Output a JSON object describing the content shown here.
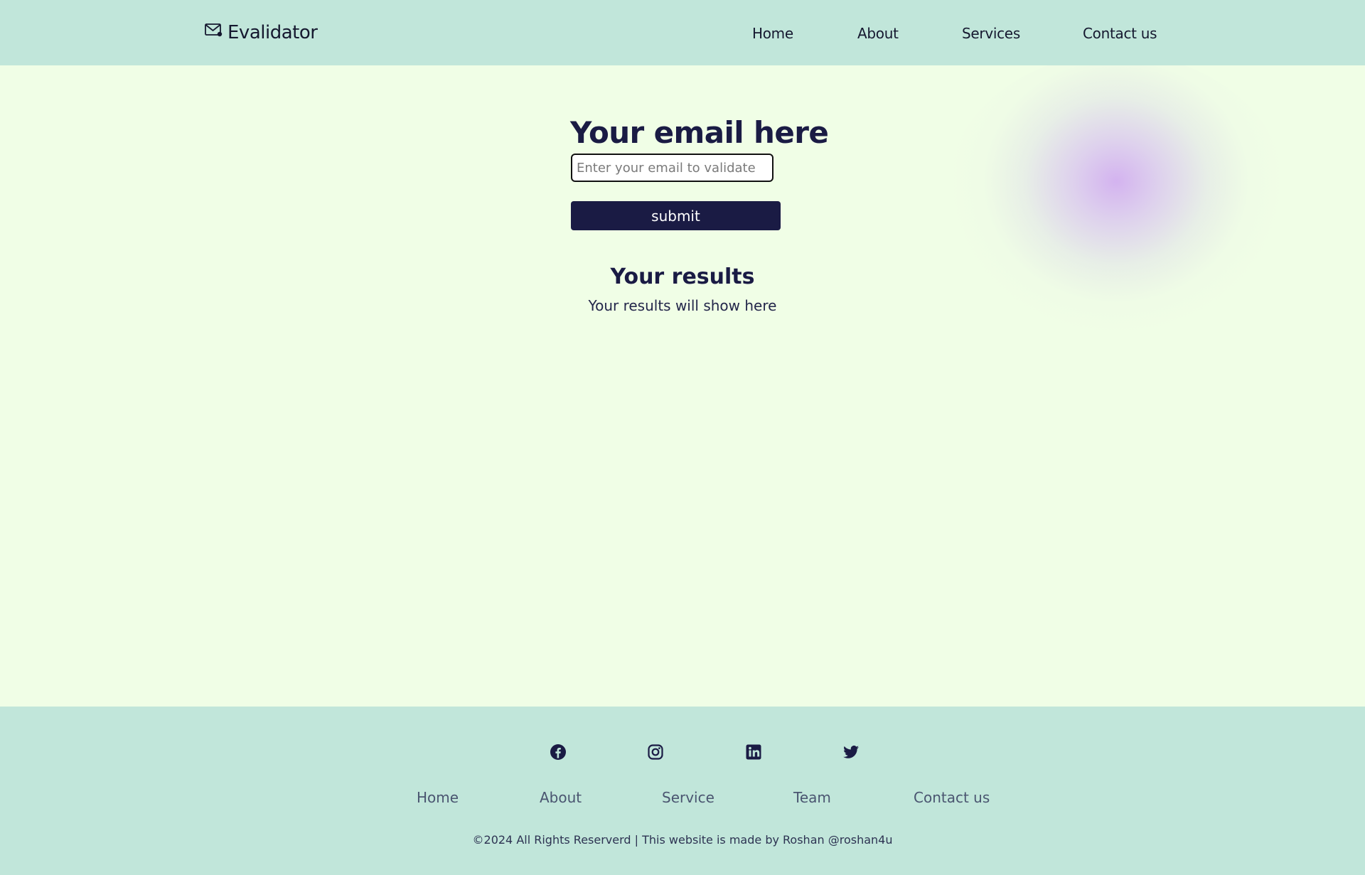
{
  "header": {
    "brand": "Evalidator",
    "brand_icon": "envelope-icon",
    "nav": [
      "Home",
      "About",
      "Services",
      "Contact us"
    ]
  },
  "main": {
    "title": "Your email here",
    "input_placeholder": "Enter your email to validate",
    "input_value": "",
    "submit_label": "submit",
    "results_title": "Your results",
    "results_text": "Your results will show here"
  },
  "footer": {
    "social_icons": [
      "facebook-icon",
      "instagram-icon",
      "linkedin-icon",
      "twitter-icon"
    ],
    "nav": [
      "Home",
      "About",
      "Service",
      "Team",
      "Contact us"
    ],
    "copyright": "©2024 All Rights Reserverd | This website is made by Roshan @roshan4u"
  },
  "colors": {
    "header_bg": "#c1e6da",
    "page_bg": "#f0fee6",
    "primary": "#1a1b44",
    "blob": "#d2aff0"
  }
}
